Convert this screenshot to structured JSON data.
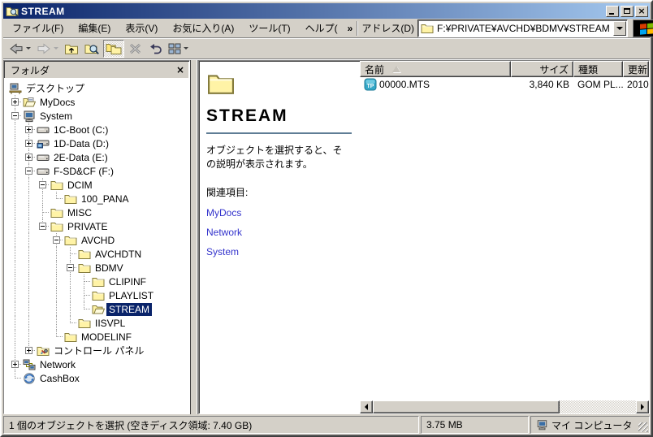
{
  "window": {
    "title": "STREAM"
  },
  "menubar": {
    "items": [
      "ファイル(F)",
      "編集(E)",
      "表示(V)",
      "お気に入り(A)",
      "ツール(T)",
      "ヘルプ("
    ],
    "overflow_chevron": "»"
  },
  "addressbar": {
    "label": "アドレス(D)",
    "value": "F:¥PRIVATE¥AVCHD¥BDMV¥STREAM"
  },
  "toolbar": {
    "buttons": [
      {
        "name": "back",
        "icon": "back-icon",
        "dropdown": true,
        "enabled": true,
        "pressed": false
      },
      {
        "name": "forward",
        "icon": "forward-icon",
        "dropdown": true,
        "enabled": false,
        "pressed": false
      },
      {
        "name": "up",
        "icon": "up-icon",
        "dropdown": false,
        "enabled": true,
        "pressed": false
      },
      {
        "name": "search",
        "icon": "search-icon",
        "dropdown": false,
        "enabled": true,
        "pressed": false
      },
      {
        "name": "folders",
        "icon": "folders-icon",
        "dropdown": false,
        "enabled": true,
        "pressed": true
      },
      {
        "name": "delete",
        "icon": "delete-icon",
        "dropdown": false,
        "enabled": true,
        "pressed": false
      },
      {
        "name": "undo",
        "icon": "undo-icon",
        "dropdown": false,
        "enabled": true,
        "pressed": false
      },
      {
        "name": "views",
        "icon": "views-icon",
        "dropdown": true,
        "enabled": true,
        "pressed": false
      }
    ]
  },
  "folders_panel": {
    "title": "フォルダ",
    "tree": [
      {
        "label": "デスクトップ",
        "level": 0,
        "icon": "desktop-icon",
        "expander": null,
        "selected": false
      },
      {
        "label": "MyDocs",
        "level": 1,
        "icon": "mydocs-icon",
        "expander": "plus",
        "selected": false
      },
      {
        "label": "System",
        "level": 1,
        "icon": "computer-icon",
        "expander": "minus",
        "selected": false
      },
      {
        "label": "1C-Boot (C:)",
        "level": 2,
        "icon": "drive-icon",
        "expander": "plus",
        "selected": false
      },
      {
        "label": "1D-Data (D:)",
        "level": 2,
        "icon": "drive-blue-icon",
        "expander": "plus",
        "selected": false
      },
      {
        "label": "2E-Data (E:)",
        "level": 2,
        "icon": "drive-icon",
        "expander": "plus",
        "selected": false
      },
      {
        "label": "F-SD&CF (F:)",
        "level": 2,
        "icon": "drive-icon",
        "expander": "minus",
        "selected": false
      },
      {
        "label": "DCIM",
        "level": 3,
        "icon": "folder-icon",
        "expander": "minus",
        "selected": false
      },
      {
        "label": "100_PANA",
        "level": 4,
        "icon": "folder-icon",
        "expander": null,
        "selected": false
      },
      {
        "label": "MISC",
        "level": 3,
        "icon": "folder-icon",
        "expander": null,
        "selected": false
      },
      {
        "label": "PRIVATE",
        "level": 3,
        "icon": "folder-icon",
        "expander": "minus",
        "selected": false
      },
      {
        "label": "AVCHD",
        "level": 4,
        "icon": "folder-icon",
        "expander": "minus",
        "selected": false
      },
      {
        "label": "AVCHDTN",
        "level": 5,
        "icon": "folder-icon",
        "expander": null,
        "selected": false
      },
      {
        "label": "BDMV",
        "level": 5,
        "icon": "folder-icon",
        "expander": "minus",
        "selected": false
      },
      {
        "label": "CLIPINF",
        "level": 6,
        "icon": "folder-icon",
        "expander": null,
        "selected": false
      },
      {
        "label": "PLAYLIST",
        "level": 6,
        "icon": "folder-icon",
        "expander": null,
        "selected": false
      },
      {
        "label": "STREAM",
        "level": 6,
        "icon": "folder-open-icon",
        "expander": null,
        "selected": true
      },
      {
        "label": "IISVPL",
        "level": 5,
        "icon": "folder-icon",
        "expander": null,
        "selected": false
      },
      {
        "label": "MODELINF",
        "level": 4,
        "icon": "folder-icon",
        "expander": null,
        "selected": false
      },
      {
        "label": "コントロール パネル",
        "level": 2,
        "icon": "control-panel-icon",
        "expander": "plus",
        "selected": false
      },
      {
        "label": "Network",
        "level": 1,
        "icon": "network-icon",
        "expander": "plus",
        "selected": false
      },
      {
        "label": "CashBox",
        "level": 1,
        "icon": "cashbox-icon",
        "expander": null,
        "selected": false
      }
    ]
  },
  "webview": {
    "icon": "folder-large-icon",
    "title": "STREAM",
    "description": "オブジェクトを選択すると、その説明が表示されます。",
    "related_label": "関連項目:",
    "links": [
      "MyDocs",
      "Network",
      "System"
    ]
  },
  "file_list": {
    "columns": [
      {
        "label": "名前",
        "align": "left",
        "sorted": "asc"
      },
      {
        "label": "サイズ",
        "align": "right",
        "sorted": null
      },
      {
        "label": "種類",
        "align": "left",
        "sorted": null
      },
      {
        "label": "更新",
        "align": "left",
        "sorted": null
      }
    ],
    "rows": [
      {
        "icon": "tp-media-icon",
        "name": "00000.MTS",
        "size": "3,840 KB",
        "type": "GOM PL...",
        "modified": "2010"
      }
    ]
  },
  "statusbar": {
    "selection_text": "1 個のオブジェクトを選択 (空きディスク領域: 7.40 GB)",
    "size_text": "3.75 MB",
    "zone_icon": "my-computer-icon",
    "zone_text": "マイ コンピュータ"
  },
  "colors": {
    "titlebar_start": "#0a246a",
    "titlebar_end": "#a6caf0",
    "chrome": "#d4d0c8",
    "selection": "#0a246a",
    "link": "#3333cc",
    "webview_rule": "#5f7d95"
  }
}
